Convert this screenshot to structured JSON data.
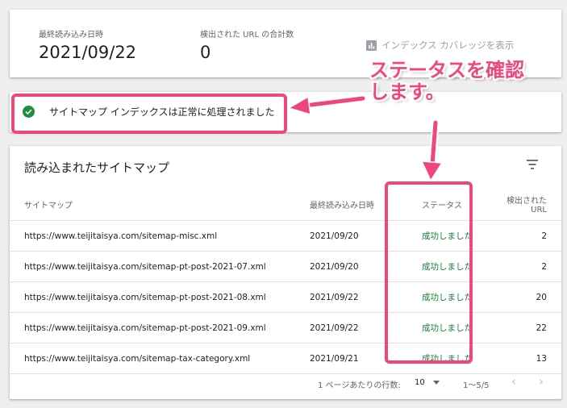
{
  "summary": {
    "last_read_label": "最終読み込み日時",
    "last_read_value": "2021/09/22",
    "url_count_label": "検出された URL の合計数",
    "url_count_value": "0",
    "coverage_link": "インデックス カバレッジを表示"
  },
  "status": {
    "message": "サイトマップ インデックスは正常に処理されました"
  },
  "annotation": {
    "line1": "ステータスを確認",
    "line2": "します。"
  },
  "table": {
    "title": "読み込まれたサイトマップ",
    "headers": {
      "sitemap": "サイトマップ",
      "last_read": "最終読み込み日時",
      "status": "ステータス",
      "urls": "検出された URL"
    },
    "rows": [
      {
        "sitemap": "https://www.teijitaisya.com/sitemap-misc.xml",
        "last_read": "2021/09/20",
        "status": "成功しました",
        "urls": "2"
      },
      {
        "sitemap": "https://www.teijitaisya.com/sitemap-pt-post-2021-07.xml",
        "last_read": "2021/09/20",
        "status": "成功しました",
        "urls": "2"
      },
      {
        "sitemap": "https://www.teijitaisya.com/sitemap-pt-post-2021-08.xml",
        "last_read": "2021/09/22",
        "status": "成功しました",
        "urls": "20"
      },
      {
        "sitemap": "https://www.teijitaisya.com/sitemap-pt-post-2021-09.xml",
        "last_read": "2021/09/22",
        "status": "成功しました",
        "urls": "22"
      },
      {
        "sitemap": "https://www.teijitaisya.com/sitemap-tax-category.xml",
        "last_read": "2021/09/21",
        "status": "成功しました",
        "urls": "13"
      }
    ],
    "pager": {
      "rows_per_page_label": "1 ページあたりの行数:",
      "rows_per_page_value": "10",
      "range": "1～5/5"
    }
  },
  "colors": {
    "accent": "#f0467e",
    "success": "#188038"
  }
}
